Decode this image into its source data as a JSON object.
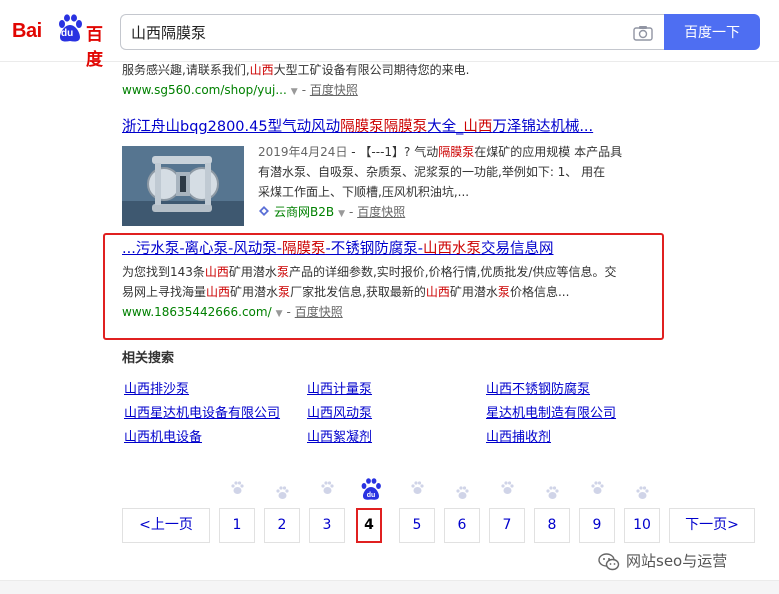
{
  "header": {
    "logo_left": "Bai",
    "logo_du": "du",
    "logo_right": "百度",
    "search_value": "山西隔膜泵",
    "search_button": "百度一下"
  },
  "results": [
    {
      "snippet_parts": [
        "服务感兴趣,请联系我们,",
        "山西",
        "大型工矿设备有限公司期待您的来电."
      ],
      "url": "www.sg560.com/shop/yuj...",
      "kuaizhao": "百度快照"
    },
    {
      "title_parts": [
        "浙江舟山bqg2800.45型气动风动",
        "隔膜泵隔膜泵",
        "大全_",
        "山西",
        "万泽锦达机械..."
      ],
      "date": "2019年4月24日",
      "snippet_line1_parts": [
        " - 【---1】? 气动",
        "隔膜泵",
        "在煤矿的应用规模 本产品具"
      ],
      "snippet_line2": "有潜水泵、自吸泵、杂质泵、泥浆泵的一功能,举例如下: 1、 用在",
      "snippet_line3": "采煤工作面上、下顺槽,压风机积油坑,...",
      "source": "云商网B2B",
      "kuaizhao": "百度快照"
    },
    {
      "title_parts": [
        "...污水泵-离心泵-风动泵-",
        "隔膜泵",
        "-不锈钢防腐泵-",
        "山西水泵",
        "交易信息网"
      ],
      "snippet_line1_parts": [
        "为您找到143条",
        "山西",
        "矿用潜水",
        "泵",
        "产品的详细参数,实时报价,价格行情,优质批发/供应等信息。交"
      ],
      "snippet_line2_parts": [
        "易网上寻找海量",
        "山西",
        "矿用潜水",
        "泵",
        "厂家批发信息,获取最新的",
        "山西",
        "矿用潜水",
        "泵",
        "价格信息..."
      ],
      "url": "www.18635442666.com/",
      "kuaizhao": "百度快照"
    }
  ],
  "related": {
    "title": "相关搜索",
    "items": [
      "山西排沙泵",
      "山西计量泵",
      "山西不锈钢防腐泵",
      "山西星达机电设备有限公司",
      "山西风动泵",
      "星达机电制造有限公司",
      "山西机电设备",
      "山西絮凝剂",
      "山西捕收剂"
    ]
  },
  "paging": {
    "prev": "<上一页",
    "pages": [
      "1",
      "2",
      "3",
      "4",
      "5",
      "6",
      "7",
      "8",
      "9",
      "10"
    ],
    "current": "4",
    "current_mark": "du",
    "next": "下一页>"
  },
  "watermark": "网站seo与运营",
  "colors": {
    "brand_red": "#e10602",
    "search_blue": "#4e6ef2",
    "link_blue": "#0000cc",
    "url_green": "#008000",
    "highlight_red": "#c00",
    "annotation_red": "#e02020"
  }
}
